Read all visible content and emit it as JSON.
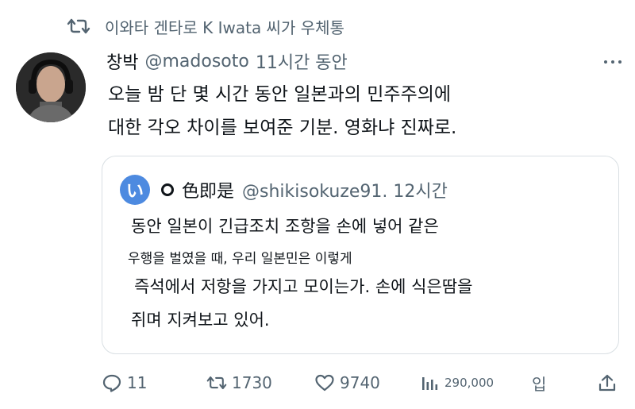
{
  "retweet_context": {
    "icon": "retweet-icon",
    "text": "이와타 겐타로 K Iwata 씨가 우체통"
  },
  "tweet": {
    "author_name": "창박",
    "handle": "@madosoto",
    "time": "11시간 동안",
    "text_lines": [
      "오늘 밤 단 몇 시간 동안 일본과의 민주주의에",
      "대한 각오 차이를 보여준 기분. 영화냐 진짜로."
    ]
  },
  "quote": {
    "avatar_letter": "い",
    "name": "色即是",
    "handle_time": "@shikisokuze91. 12시간",
    "text_lines": [
      "동안 일본이 긴급조치 조항을 손에 넣어 같은",
      "우행을 벌였을 때, 우리 일본민은 이렇게",
      "즉석에서 저항을 가지고 모이는가. 손에 식은땀을",
      "쥐며 지켜보고 있어."
    ]
  },
  "actions": {
    "reply_count": "11",
    "retweet_count": "1730",
    "like_count": "9740",
    "views_count": "290,000",
    "bookmark_label": "입"
  },
  "colors": {
    "muted": "#536471",
    "text": "#0f1419",
    "quote_avatar": "#4d8ae0"
  }
}
